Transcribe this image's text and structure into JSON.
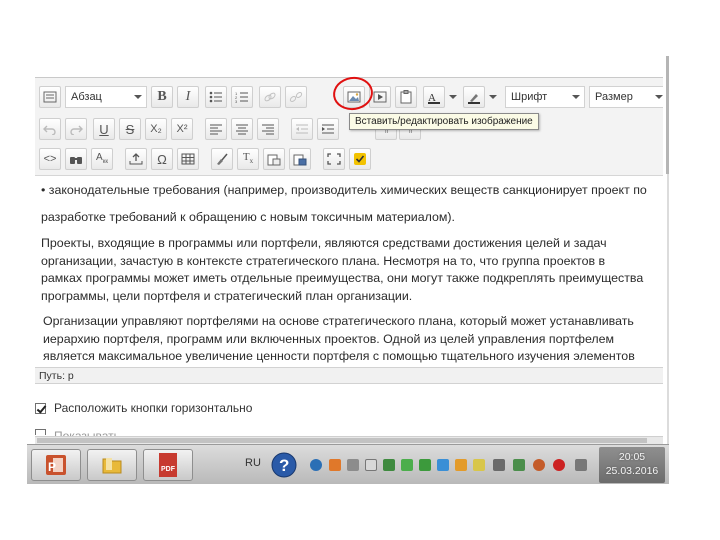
{
  "toolbar": {
    "format_select": "Абзац",
    "font_select": "Шрифт",
    "size_select": "Размер",
    "subscript": "X₂",
    "superscript": "X²",
    "omega": "Ω",
    "tooltip": "Вставить/редактировать изображение"
  },
  "content": {
    "p1": "• законодательные требования (например, производитель химических веществ санкционирует проект по",
    "p2": "разработке требований к обращению с новым токсичным материалом).",
    "p3": "Проекты, входящие в программы или портфели, являются средствами достижения целей и задач организации, зачастую в контексте стратегического плана. Несмотря на то, что группа проектов в рамках программы может иметь отдельные преимущества, они могут также подкреплять преимущества программы, цели портфеля и стратегический план организации.",
    "p4": "Организации управляют портфелями на основе стратегического плана, который может устанавливать иерархию портфеля, программ или включенных проектов. Одной из целей управления портфелем является максимальное увеличение ценности портфеля с помощью тщательного изучения элементов"
  },
  "path_bar": "Путь: p",
  "option_horizontal": "Расположить кнопки горизонтально",
  "option_second": "Показывать",
  "taskbar": {
    "lang": "RU",
    "time": "20:05",
    "date": "25.03.2016",
    "pdf_label": "PDF"
  },
  "colors": {
    "highlight_circle": "#e01010",
    "tooltip_bg": "#fbfbe6"
  }
}
